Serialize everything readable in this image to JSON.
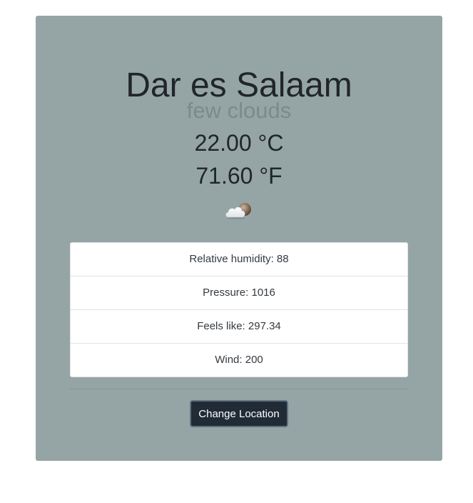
{
  "weather": {
    "city": "Dar es Salaam",
    "description": "few clouds",
    "temp_c": "22.00 °C",
    "temp_f": "71.60 °F",
    "icon": "few-clouds-night-icon"
  },
  "details": [
    {
      "label": "Relative humidity: 88"
    },
    {
      "label": "Pressure: 1016"
    },
    {
      "label": "Feels like: 297.34"
    },
    {
      "label": "Wind: 200"
    }
  ],
  "actions": {
    "change_location_label": "Change Location"
  },
  "colors": {
    "card_bg": "#95a5a6",
    "button_bg": "#212b36",
    "description_text": "#7b8a8b"
  }
}
